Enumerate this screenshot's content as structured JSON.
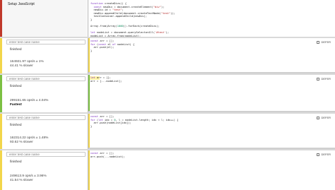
{
  "setup": {
    "label": "Setup JavaScript",
    "code": [
      [
        "fn",
        "function createDivs() {"
      ],
      [
        "",
        "  const newDiv = document.createElement(\"div\");"
      ],
      [
        "",
        "  newDiv.id = \"test\";"
      ],
      [
        "",
        "  newDiv.appendChild(document.createTextNode(\"test\"));"
      ],
      [
        "",
        "  testContainer.appendChild(newDiv);"
      ],
      [
        "",
        "}"
      ],
      [
        "",
        ""
      ],
      [
        "",
        "Array.from(Array(1000)).forEach(createDivs);"
      ],
      [
        "",
        ""
      ],
      [
        "",
        "let nodeList = document.querySelectorAll('#test');"
      ],
      [
        "",
        "nodeList = Array.from(nodeList);"
      ]
    ]
  },
  "placeholder": "enter test case name",
  "defer_label": "DEFER",
  "colors": {
    "setup_stripe": "#c0392b",
    "yellow_stripe": "#f2d64b",
    "green_stripe": "#7cc043",
    "fastest_editor_bg": "#fffbe0"
  },
  "tests": [
    {
      "status": "finished",
      "ops": "164921.97 ops/s ± 1%",
      "result": "44.41 % slower",
      "fastest": false,
      "code": [
        "const arr = [];",
        "for (const el of nodeList) {",
        "  arr.push(el);",
        "}"
      ]
    },
    {
      "status": "finished",
      "ops": "299151.65 ops/s ± 4.04%",
      "result": "Fastest",
      "fastest": true,
      "code": [
        "let arr = [];",
        "arr = [...nodeList];"
      ]
    },
    {
      "status": "finished",
      "ops": "162314.22 ops/s ± 1.48%",
      "result": "93.62 % slower",
      "fastest": false,
      "code": [
        "const arr = [];",
        "for (let idx = 0, l = nodeList.length; idx < l; idx++) {",
        "  arr.push(nodeList[idx]);",
        "}"
      ]
    },
    {
      "status": "finished",
      "ops": "249613.9 ops/s ± 3.96%",
      "result": "41.54 % slower",
      "fastest": false,
      "code": [
        "const arr = [];",
        "arr.push(...nodeList);"
      ]
    }
  ]
}
